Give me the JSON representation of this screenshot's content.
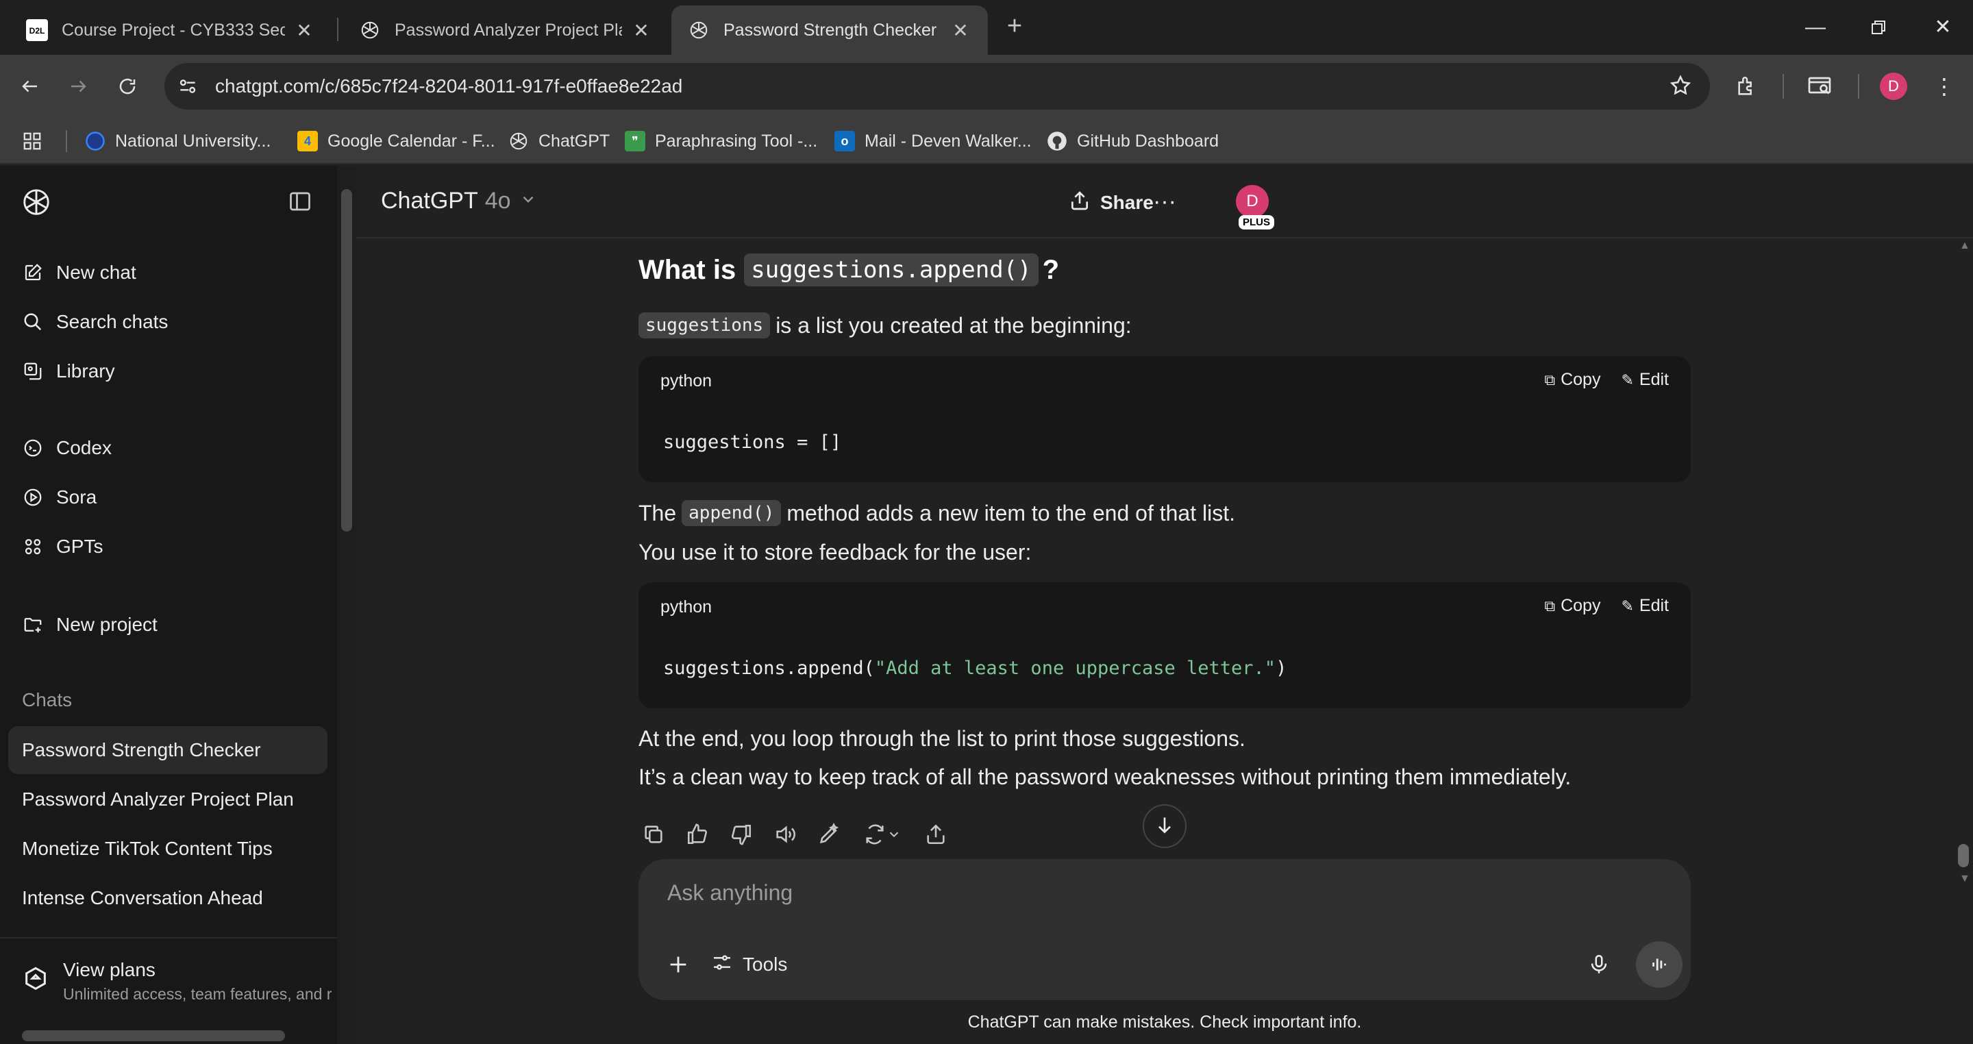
{
  "browser": {
    "tabs": [
      {
        "title": "Course Project - CYB333 Security",
        "favicon": "d2l-logo-icon",
        "active": false
      },
      {
        "title": "Password Analyzer Project Plan",
        "favicon": "chatgpt-logo-icon",
        "active": false
      },
      {
        "title": "Password Strength Checker",
        "favicon": "chatgpt-logo-icon",
        "active": true
      }
    ],
    "url": "chatgpt.com/c/685c7f24-8204-8011-917f-e0ffae8e22ad",
    "profile_initial": "D",
    "bookmarks": [
      {
        "label": "National University...",
        "icon": "globe-icon"
      },
      {
        "label": "Google Calendar - F...",
        "icon": "calendar-icon",
        "badge": "4"
      },
      {
        "label": "ChatGPT",
        "icon": "chatgpt-logo-icon"
      },
      {
        "label": "Paraphrasing Tool -...",
        "icon": "quillbot-icon"
      },
      {
        "label": "Mail - Deven Walker...",
        "icon": "outlook-icon"
      },
      {
        "label": "GitHub Dashboard",
        "icon": "github-icon"
      }
    ]
  },
  "sidebar": {
    "nav": [
      {
        "label": "New chat",
        "icon": "new-chat-icon"
      },
      {
        "label": "Search chats",
        "icon": "search-icon"
      },
      {
        "label": "Library",
        "icon": "library-icon"
      }
    ],
    "tools": [
      {
        "label": "Codex",
        "icon": "codex-icon"
      },
      {
        "label": "Sora",
        "icon": "sora-icon"
      },
      {
        "label": "GPTs",
        "icon": "gpts-grid-icon"
      }
    ],
    "new_project": "New project",
    "chats_heading": "Chats",
    "chats": [
      {
        "label": "Password Strength Checker",
        "active": true
      },
      {
        "label": "Password Analyzer Project Plan",
        "active": false
      },
      {
        "label": "Monetize TikTok Content Tips",
        "active": false
      },
      {
        "label": "Intense Conversation Ahead",
        "active": false
      }
    ],
    "footer": {
      "title": "View plans",
      "subtitle": "Unlimited access, team features, and r"
    }
  },
  "header": {
    "model": "ChatGPT",
    "model_version": "4o",
    "share": "Share",
    "user_initial": "D",
    "plan_badge": "PLUS"
  },
  "message": {
    "heading_prefix": "What is",
    "heading_code": "suggestions.append()",
    "heading_suffix": "?",
    "p1_code": "suggestions",
    "p1_text": "is a list you created at the beginning:",
    "code1": {
      "lang": "python",
      "copy": "Copy",
      "edit": "Edit",
      "code": "suggestions = []"
    },
    "p2_prefix": "The",
    "p2_code": "append()",
    "p2_text": "method adds a new item to the end of that list.",
    "p3": "You use it to store feedback for the user:",
    "code2": {
      "lang": "python",
      "copy": "Copy",
      "edit": "Edit",
      "code_prefix": "suggestions.append(",
      "code_string": "\"Add at least one uppercase letter.\"",
      "code_suffix": ")"
    },
    "p4": "At the end, you loop through the list to print those suggestions.",
    "p5": "It’s a clean way to keep track of all the password weaknesses without printing them immediately."
  },
  "composer": {
    "placeholder": "Ask anything",
    "tools": "Tools"
  },
  "disclaimer": "ChatGPT can make mistakes. Check important info.",
  "colors": {
    "avatar": "#d63c72",
    "string_literal": "#7ec699",
    "background": "#212121",
    "sidebar": "#181818"
  }
}
